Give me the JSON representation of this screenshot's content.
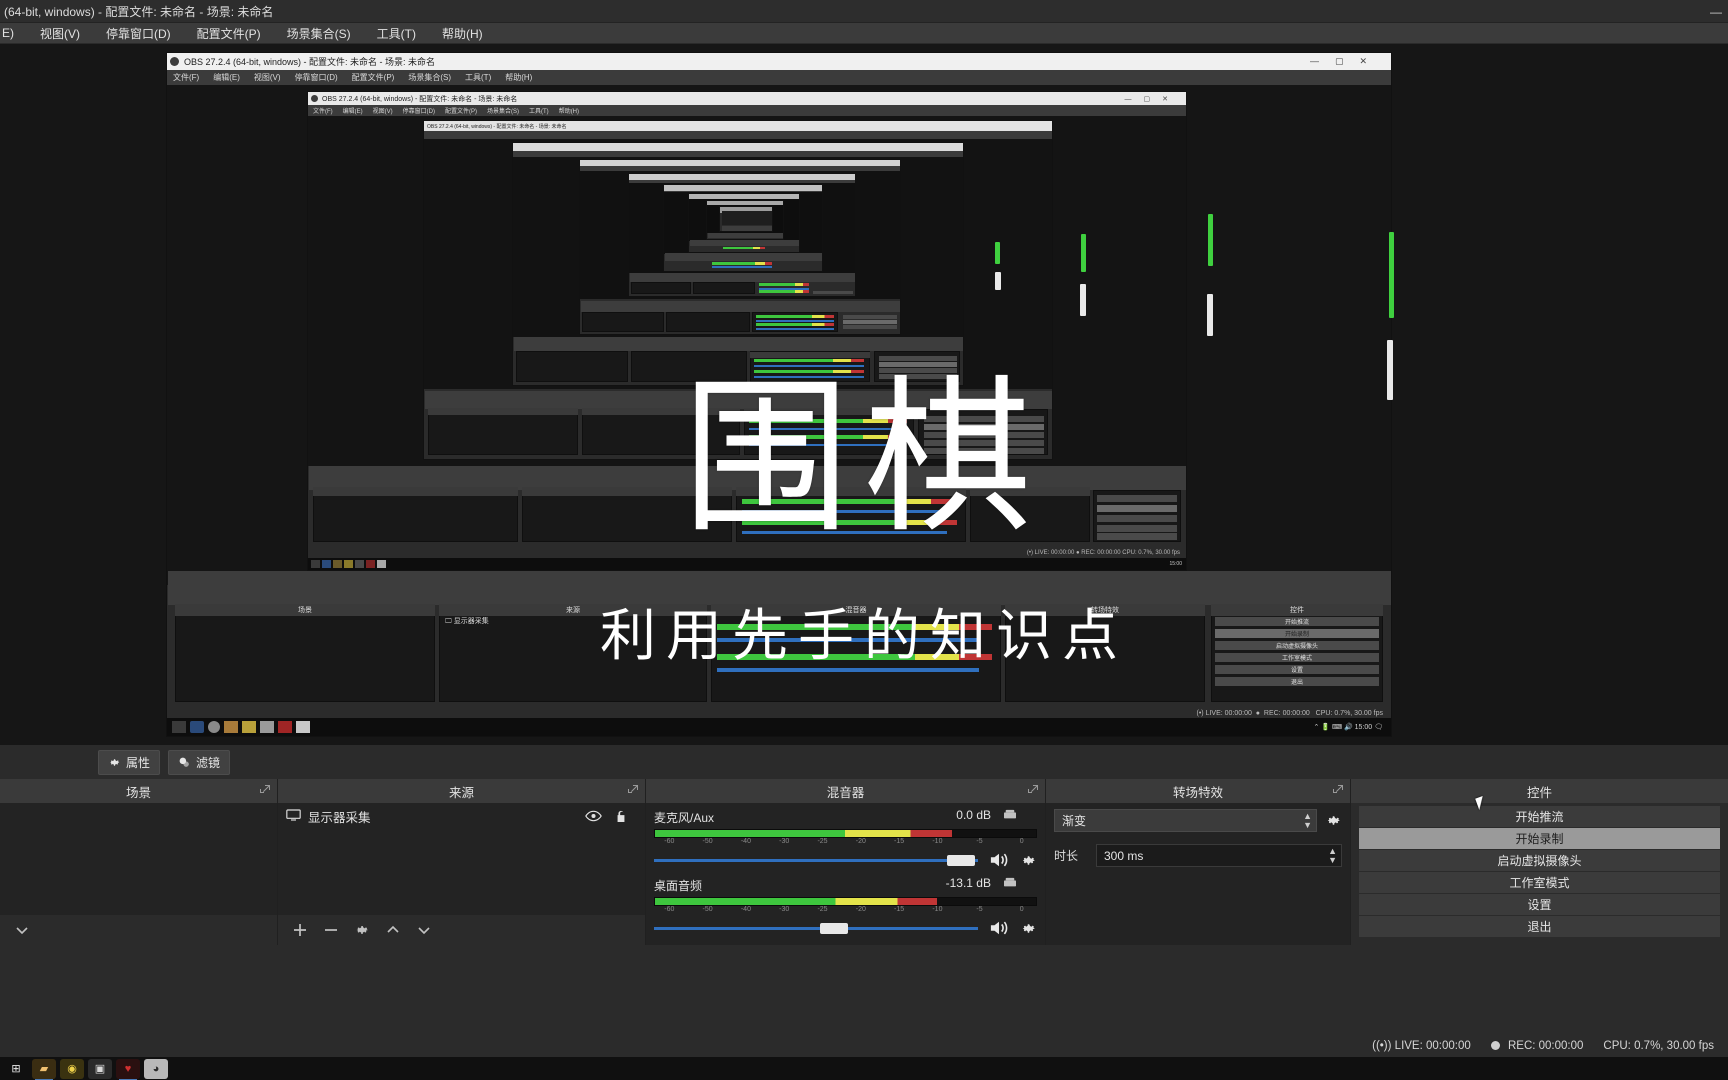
{
  "window": {
    "title": "(64-bit, windows) - 配置文件: 未命名 - 场景: 未命名",
    "nested_title": "OBS 27.2.4 (64-bit, windows) - 配置文件: 未命名 - 场景: 未命名",
    "minimize": "—",
    "maximize": "▢",
    "close": "✕"
  },
  "menu": {
    "items": [
      {
        "label": "E)"
      },
      {
        "label": "视图(V)"
      },
      {
        "label": "停靠窗口(D)"
      },
      {
        "label": "配置文件(P)"
      },
      {
        "label": "场景集合(S)"
      },
      {
        "label": "工具(T)"
      },
      {
        "label": "帮助(H)"
      }
    ],
    "nested_items": [
      "文件(F)",
      "编辑(E)",
      "视图(V)",
      "停靠窗口(D)",
      "配置文件(P)",
      "场景集合(S)",
      "工具(T)",
      "帮助(H)"
    ]
  },
  "overlay": {
    "title": "围棋",
    "subtitle": "利用先手的知识点"
  },
  "toolbar": {
    "properties_label": "属性",
    "filters_label": "滤镜",
    "properties_icon": "gear-icon",
    "filters_icon": "filter-icon"
  },
  "panels": {
    "scenes": {
      "title": "场景",
      "items": [],
      "footer_icons": [
        "plus-icon",
        "minus-icon",
        "chevron-up-icon",
        "chevron-down-icon"
      ]
    },
    "sources": {
      "title": "来源",
      "items": [
        {
          "name": "显示器采集",
          "icon": "monitor-icon",
          "visible": true,
          "locked": true
        }
      ],
      "footer_icons": [
        "plus-icon",
        "minus-icon",
        "gear-icon",
        "chevron-up-icon",
        "chevron-down-icon"
      ]
    },
    "mixer": {
      "title": "混音器",
      "tracks": [
        {
          "name": "麦克风/Aux",
          "db": "0.0 dB",
          "level_pct": 78,
          "volume_pct": 99,
          "ticks": [
            "-60",
            "-50",
            "-40",
            "-30",
            "-25",
            "-20",
            "-15",
            "-10",
            "-5",
            "0"
          ],
          "mute_icon": "speaker-icon",
          "settings_icon": "gear-icon"
        },
        {
          "name": "桌面音频",
          "db": "-13.1 dB",
          "level_pct": 74,
          "volume_pct": 60,
          "ticks": [
            "-60",
            "-50",
            "-40",
            "-30",
            "-25",
            "-20",
            "-15",
            "-10",
            "-5",
            "0"
          ],
          "mute_icon": "speaker-icon",
          "settings_icon": "gear-icon"
        }
      ]
    },
    "transitions": {
      "title": "转场特效",
      "transition_value": "渐变",
      "duration_label": "时长",
      "duration_value": "300 ms",
      "settings_icon": "gear-icon"
    },
    "controls": {
      "title": "控件",
      "buttons": [
        {
          "label": "开始推流",
          "selected": false
        },
        {
          "label": "开始录制",
          "selected": true
        },
        {
          "label": "启动虚拟摄像头",
          "selected": false
        },
        {
          "label": "工作室模式",
          "selected": false
        },
        {
          "label": "设置",
          "selected": false
        },
        {
          "label": "退出",
          "selected": false
        }
      ]
    }
  },
  "statusbar": {
    "live_label": "LIVE: 00:00:00",
    "rec_label": "REC: 00:00:00",
    "cpu_label": "CPU: 0.7%, 30.00 fps",
    "live_icon": "broadcast-icon",
    "rec_icon": "record-dot-icon"
  },
  "nested_statusbar": {
    "live_label": "(•) LIVE: 00:00:00",
    "rec_label": "REC: 00:00:00",
    "cpu_label": "CPU: 0.7%, 30.00 fps"
  },
  "taskbar": {
    "clock": "15:00",
    "items": [
      {
        "name": "start-button",
        "glyph": "⊞",
        "color": "#e8e8e8",
        "bg": "transparent"
      },
      {
        "name": "taskbar-app-folder",
        "glyph": "▰",
        "color": "#f0c070",
        "bg": "#3a2d12"
      },
      {
        "name": "taskbar-app-browser",
        "glyph": "◉",
        "color": "#f0d24a",
        "bg": "#3a3210"
      },
      {
        "name": "taskbar-app-camera",
        "glyph": "▣",
        "color": "#d9d9d9",
        "bg": "#2a2a2a"
      },
      {
        "name": "taskbar-app-heart",
        "glyph": "♥",
        "color": "#d03030",
        "bg": "#2a1010"
      },
      {
        "name": "taskbar-app-obs",
        "glyph": "◕",
        "color": "#2b2b2b",
        "bg": "#b8b8b8"
      }
    ]
  },
  "colors": {
    "panel_bg": "#2b2b2b",
    "panel_dark": "#232323",
    "header": "#3a3a3a",
    "accent_blue": "#2f6fbe",
    "meter_green": "#3ec63e",
    "meter_yellow": "#e3e34a",
    "meter_red": "#c03535",
    "selected": "#9a9a9a"
  }
}
